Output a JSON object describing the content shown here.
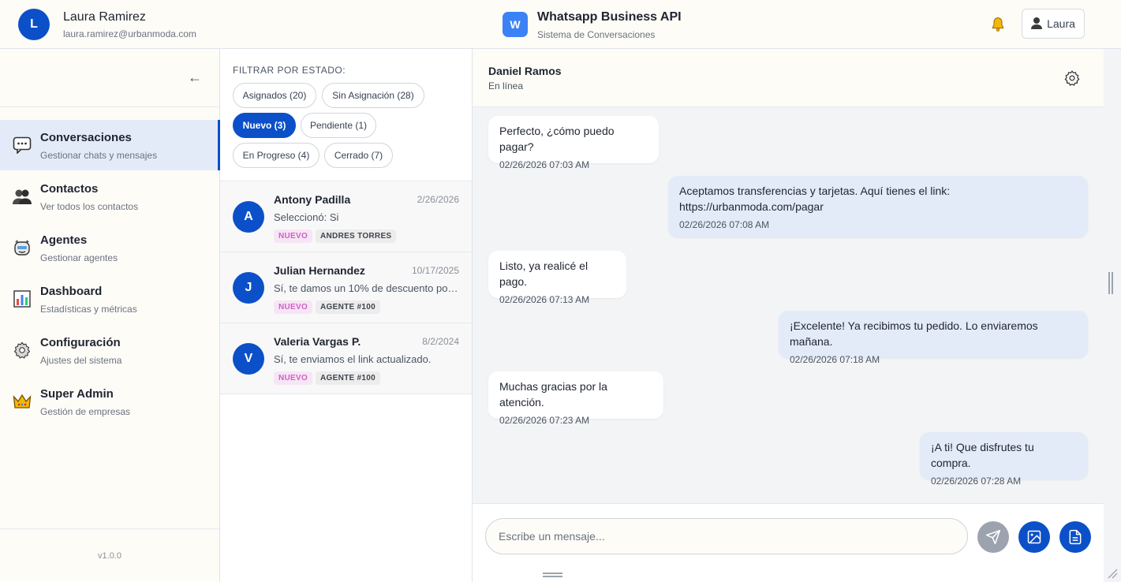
{
  "header": {
    "user": {
      "initial": "L",
      "name": "Laura Ramirez",
      "email": "laura.ramirez@urbanmoda.com"
    },
    "brand": {
      "logo_letter": "W",
      "title": "Whatsapp Business API",
      "subtitle": "Sistema de Conversaciones"
    },
    "notifications_icon": "bell-icon",
    "profile_button": {
      "icon": "person-icon",
      "label": "Laura"
    }
  },
  "sidebar": {
    "collapse_icon": "arrow-left-icon",
    "items": [
      {
        "id": "conversaciones",
        "icon": "chat-bubble-icon",
        "title": "Conversaciones",
        "subtitle": "Gestionar chats y mensajes",
        "active": true
      },
      {
        "id": "contactos",
        "icon": "people-icon",
        "title": "Contactos",
        "subtitle": "Ver todos los contactos",
        "active": false
      },
      {
        "id": "agentes",
        "icon": "robot-icon",
        "title": "Agentes",
        "subtitle": "Gestionar agentes",
        "active": false
      },
      {
        "id": "dashboard",
        "icon": "bar-chart-icon",
        "title": "Dashboard",
        "subtitle": "Estadísticas y métricas",
        "active": false
      },
      {
        "id": "configuracion",
        "icon": "gear-icon",
        "title": "Configuración",
        "subtitle": "Ajustes del sistema",
        "active": false
      },
      {
        "id": "superadmin",
        "icon": "crown-icon",
        "title": "Super Admin",
        "subtitle": "Gestión de empresas",
        "active": false
      }
    ],
    "version": "v1.0.0"
  },
  "filters": {
    "label": "FILTRAR POR ESTADO:",
    "chips": [
      {
        "label": "Asignados (20)",
        "active": false
      },
      {
        "label": "Sin Asignación (28)",
        "active": false
      },
      {
        "label": "Nuevo (3)",
        "active": true
      },
      {
        "label": "Pendiente (1)",
        "active": false
      },
      {
        "label": "En Progreso (4)",
        "active": false
      },
      {
        "label": "Cerrado (7)",
        "active": false
      }
    ]
  },
  "conversations": [
    {
      "initial": "A",
      "name": "Antony Padilla",
      "date": "2/26/2026",
      "preview": "Seleccionó: Si",
      "status": "NUEVO",
      "agent": "ANDRES TORRES"
    },
    {
      "initial": "J",
      "name": "Julian Hernandez",
      "date": "10/17/2025",
      "preview": "Sí, te damos un 10% de descuento por ...",
      "status": "NUEVO",
      "agent": "AGENTE #100"
    },
    {
      "initial": "V",
      "name": "Valeria Vargas P.",
      "date": "8/2/2024",
      "preview": "Sí, te enviamos el link actualizado.",
      "status": "NUEVO",
      "agent": "AGENTE #100"
    }
  ],
  "chat": {
    "contact_name": "Daniel Ramos",
    "contact_status": "En línea",
    "settings_icon": "gear-icon",
    "messages": [
      {
        "direction": "in",
        "text": "Perfecto, ¿cómo puedo pagar?",
        "time": "02/26/2026 07:03 AM"
      },
      {
        "direction": "out",
        "text": "Aceptamos transferencias y tarjetas. Aquí tienes el link:",
        "text2": "https://urbanmoda.com/pagar",
        "time": "02/26/2026 07:08 AM"
      },
      {
        "direction": "in",
        "text": "Listo, ya realicé el pago.",
        "time": "02/26/2026 07:13 AM"
      },
      {
        "direction": "out",
        "text": "¡Excelente! Ya recibimos tu pedido. Lo enviaremos mañana.",
        "time": "02/26/2026 07:18 AM"
      },
      {
        "direction": "in",
        "text": "Muchas gracias por la atención.",
        "time": "02/26/2026 07:23 AM"
      },
      {
        "direction": "out",
        "text": "¡A ti! Que disfrutes tu compra.",
        "time": "02/26/2026 07:28 AM"
      }
    ],
    "composer": {
      "placeholder": "Escribe un mensaje...",
      "send_icon": "send-icon",
      "image_icon": "image-icon",
      "document_icon": "document-icon"
    }
  },
  "colors": {
    "primary": "#0b50c8",
    "brand_logo": "#3b82f6",
    "active_nav_bg": "#e3ebf8",
    "status_tag_text": "#d05fc6",
    "status_tag_bg": "#f6e6f5",
    "send_disabled": "#9ca3af"
  }
}
